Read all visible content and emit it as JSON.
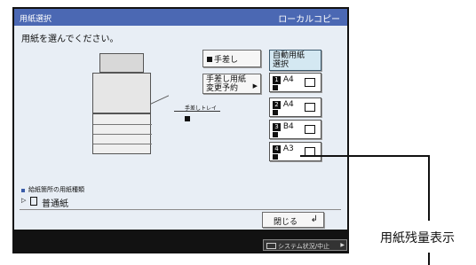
{
  "window": {
    "title": "用紙選択",
    "mode": "ローカルコピー"
  },
  "main": {
    "instruction": "用紙を選んでください。"
  },
  "buttons": {
    "manual_feed": "手差し",
    "manual_reserve_line1": "手差し用紙",
    "manual_reserve_line2": "変更予約",
    "auto_paper_line1": "自動用紙",
    "auto_paper_line2": "選択",
    "close": "閉じる"
  },
  "drawers": [
    {
      "number": "1",
      "size": "A4"
    },
    {
      "number": "2",
      "size": "A4"
    },
    {
      "number": "3",
      "size": "B4"
    },
    {
      "number": "4",
      "size": "A3"
    }
  ],
  "tray_label": "手差しトレイ",
  "info": {
    "section_label": "給紙箇所の用紙種類",
    "paper_type": "普通紙"
  },
  "footer": {
    "system_status": "システム状況/中止"
  },
  "callout": {
    "label": "用紙残量表示"
  }
}
